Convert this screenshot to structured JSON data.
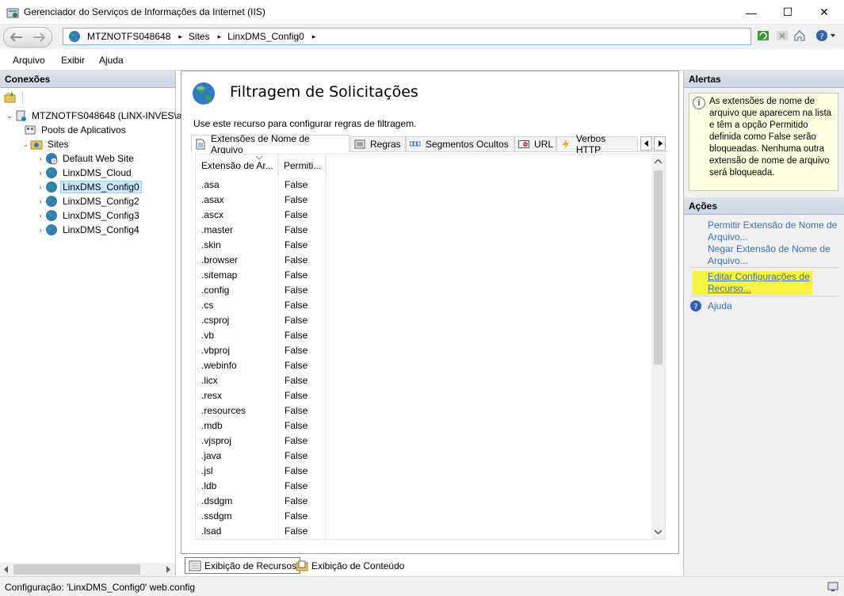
{
  "window": {
    "title": "Gerenciador do Serviços de Informações da Internet (IIS)",
    "minimize_glyph": "—",
    "maximize_glyph": "☐",
    "close_glyph": "✕"
  },
  "address": {
    "breadcrumbs": [
      "MTZNOTFS048648",
      "Sites",
      "LinxDMS_Config0"
    ],
    "sep": "▸"
  },
  "menu": [
    "Arquivo",
    "Exibir",
    "Ajuda"
  ],
  "connections": {
    "title": "Conexões",
    "tree": [
      {
        "label": "MTZNOTFS048648 (LINX-INVES\\a",
        "expander": "⌄"
      },
      {
        "label": "Pools de Aplicativos",
        "expander": ""
      },
      {
        "label": "Sites",
        "expander": "⌄"
      },
      {
        "label": "Default Web Site",
        "expander": "›"
      },
      {
        "label": "LinxDMS_Cloud",
        "expander": "›"
      },
      {
        "label": "LinxDMS_Config0",
        "expander": "›"
      },
      {
        "label": "LinxDMS_Config2",
        "expander": "›"
      },
      {
        "label": "LinxDMS_Config3",
        "expander": "›"
      },
      {
        "label": "LinxDMS_Config4",
        "expander": "›"
      }
    ]
  },
  "main": {
    "title": "Filtragem de Solicitações",
    "description": "Use este recurso para configurar regras de filtragem.",
    "tabs": [
      "Extensões de Nome de Arquivo",
      "Regras",
      "Segmentos Ocultos",
      "URL",
      "Verbos HTTP"
    ],
    "columns": [
      "Extensão de Ar...",
      "Permiti..."
    ],
    "rows": [
      [
        ".asa",
        "False"
      ],
      [
        ".asax",
        "False"
      ],
      [
        ".ascx",
        "False"
      ],
      [
        ".master",
        "False"
      ],
      [
        ".skin",
        "False"
      ],
      [
        ".browser",
        "False"
      ],
      [
        ".sitemap",
        "False"
      ],
      [
        ".config",
        "False"
      ],
      [
        ".cs",
        "False"
      ],
      [
        ".csproj",
        "False"
      ],
      [
        ".vb",
        "False"
      ],
      [
        ".vbproj",
        "False"
      ],
      [
        ".webinfo",
        "False"
      ],
      [
        ".licx",
        "False"
      ],
      [
        ".resx",
        "False"
      ],
      [
        ".resources",
        "False"
      ],
      [
        ".mdb",
        "False"
      ],
      [
        ".vjsproj",
        "False"
      ],
      [
        ".java",
        "False"
      ],
      [
        ".jsl",
        "False"
      ],
      [
        ".ldb",
        "False"
      ],
      [
        ".dsdgm",
        "False"
      ],
      [
        ".ssdgm",
        "False"
      ],
      [
        ".lsad",
        "False"
      ]
    ]
  },
  "bottom_tabs": [
    "Exibição de Recursos",
    "Exibição de Conteúdo"
  ],
  "alerts": {
    "title": "Alertas",
    "text": "As extensões de nome de arquivo que aparecem na lista e têm a opção Permitido definida como False serão bloqueadas. Nenhuma outra extensão de nome de arquivo será bloqueada."
  },
  "actions": {
    "title": "Ações",
    "items": [
      "Permitir Extensão de Nome de Arquivo...",
      "Negar Extensão de Nome de Arquivo...",
      "Editar Configurações de Recurso...",
      "Ajuda"
    ]
  },
  "status": {
    "text": "Configuração: 'LinxDMS_Config0' web.config"
  },
  "colors": {
    "highlight": "#f7f442",
    "link": "#3e6fad",
    "panel_header": "#ccd5e1"
  }
}
